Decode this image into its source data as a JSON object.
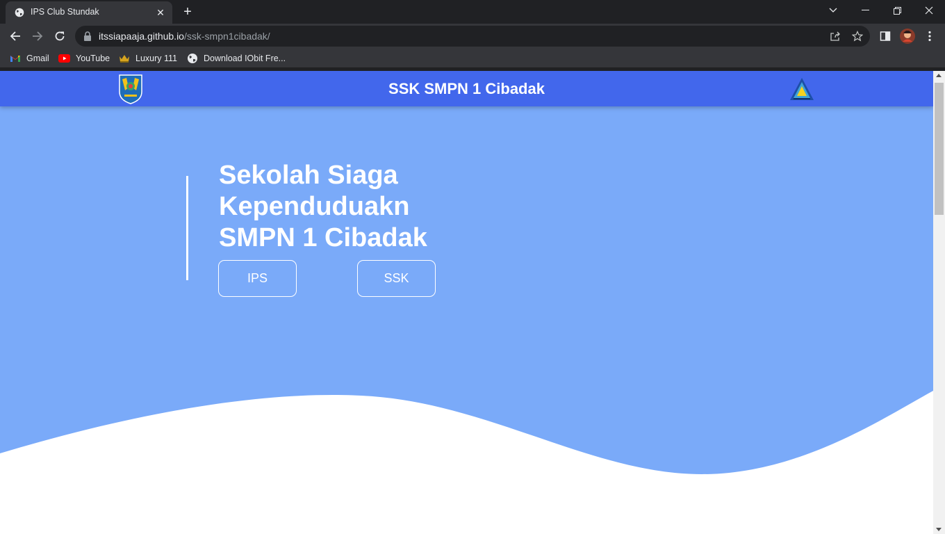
{
  "browser": {
    "tab_title": "IPS Club Stundak",
    "url_host": "itssiapaaja.github.io",
    "url_path": "/ssk-smpn1cibadak/",
    "bookmarks": [
      "Gmail",
      "YouTube",
      "Luxury 111",
      "Download IObit Fre..."
    ]
  },
  "site": {
    "header_title": "SSK SMPN 1 Cibadak",
    "hero_lines": [
      "Sekolah Siaga",
      "Kependuduakn",
      "SMPN 1 Cibadak"
    ],
    "buttons": [
      "IPS",
      "SSK"
    ]
  },
  "colors": {
    "header_bg": "#4267ec",
    "hero_bg": "#7aaaf9",
    "wave": "#ffffff"
  }
}
